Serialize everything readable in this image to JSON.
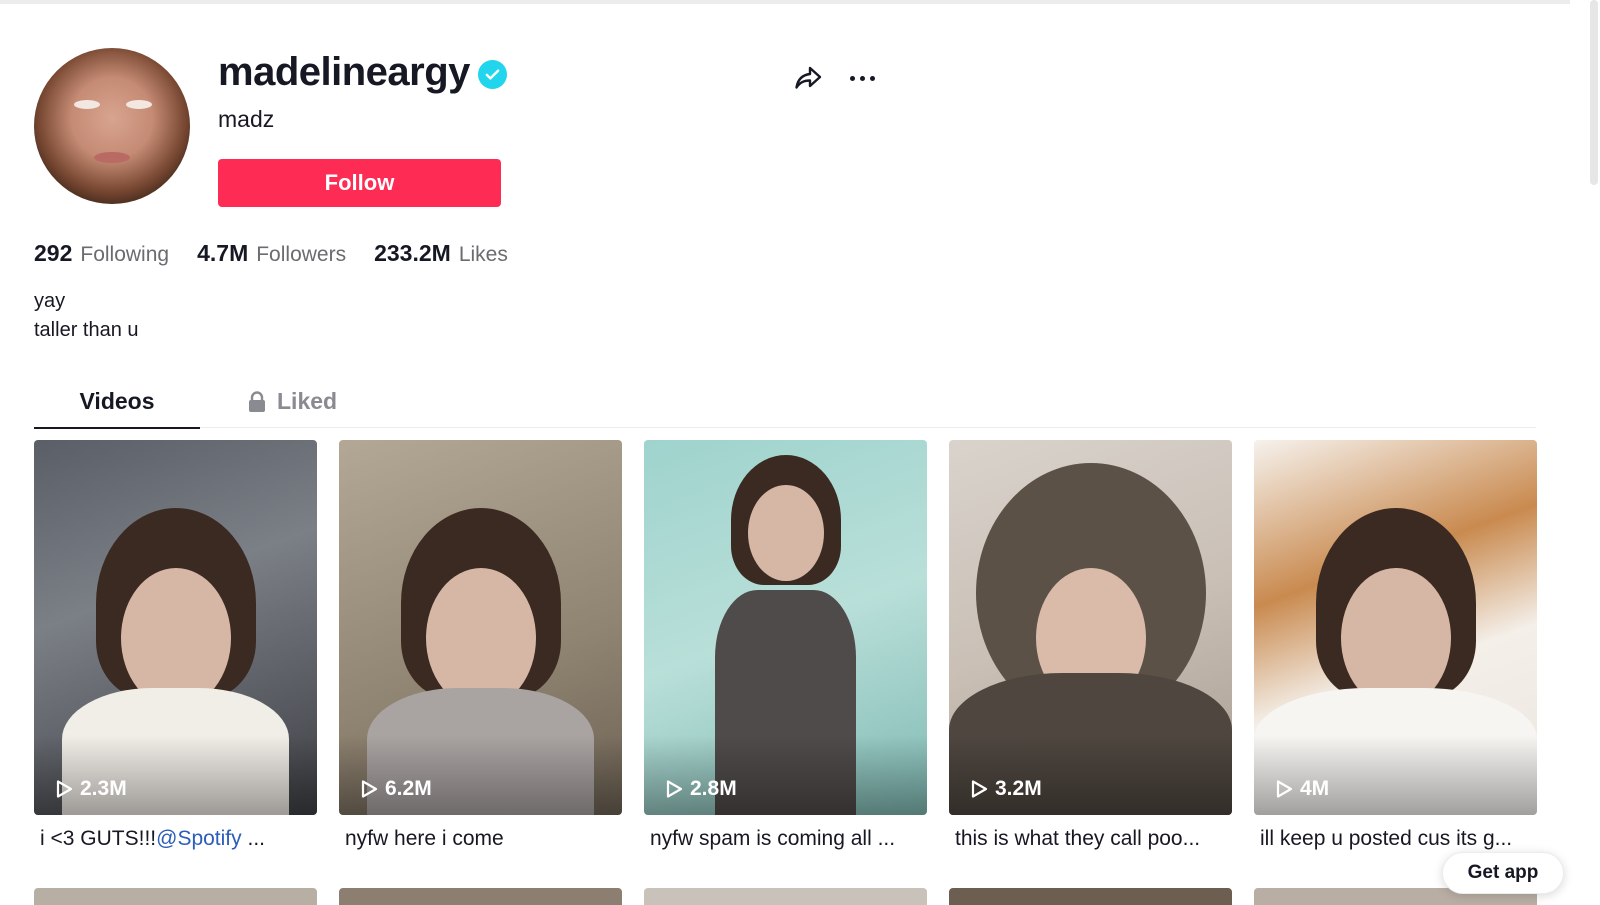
{
  "profile": {
    "username": "madelineargy",
    "nickname": "madz",
    "follow_label": "Follow",
    "verified_color": "#20d5ec"
  },
  "stats": [
    {
      "value": "292",
      "label": "Following"
    },
    {
      "value": "4.7M",
      "label": "Followers"
    },
    {
      "value": "233.2M",
      "label": "Likes"
    }
  ],
  "bio": {
    "line1": "yay",
    "line2": "taller than u"
  },
  "tabs": {
    "videos": "Videos",
    "liked": "Liked"
  },
  "videos": [
    {
      "views": "2.3M",
      "caption_prefix": "i <3 GUTS!!!",
      "mention": "@Spotify",
      "caption_suffix": " ..."
    },
    {
      "views": "6.2M",
      "caption": "nyfw here i come"
    },
    {
      "views": "2.8M",
      "caption": "nyfw spam is coming all ..."
    },
    {
      "views": "3.2M",
      "caption": "this is what they call poo..."
    },
    {
      "views": "4M",
      "caption": "ill keep u posted cus its g..."
    }
  ],
  "get_app_label": "Get app",
  "colors": {
    "accent": "#fe2c55",
    "mention": "#2b5db9",
    "text": "#161823",
    "muted": "#6b6b70"
  }
}
